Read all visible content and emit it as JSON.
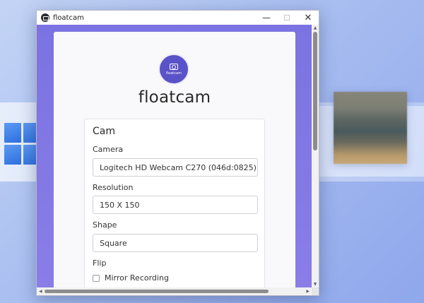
{
  "window": {
    "title": "floatcam",
    "icons": {
      "app": "camera-app-icon",
      "minimize": "minimize-icon",
      "maximize": "maximize-icon",
      "close": "close-icon"
    },
    "minimize_glyph": "—",
    "close_glyph": "✕"
  },
  "brand": {
    "logo_text": "floatcam",
    "title": "floatcam",
    "logo_icon": "camera-icon",
    "accent_color": "#5a52c8",
    "background_color": "#8478e4"
  },
  "cam_section": {
    "title": "Cam",
    "camera": {
      "label": "Camera",
      "value": "Logitech HD Webcam C270 (046d:0825)"
    },
    "resolution": {
      "label": "Resolution",
      "value": "150 X 150"
    },
    "shape": {
      "label": "Shape",
      "value": "Square"
    },
    "flip": {
      "label": "Flip",
      "option_label": "Mirror Recording",
      "checked": false
    }
  },
  "scrollbars": {
    "up_glyph": "▲",
    "down_glyph": "▼",
    "left_glyph": "◀",
    "right_glyph": "▶"
  }
}
